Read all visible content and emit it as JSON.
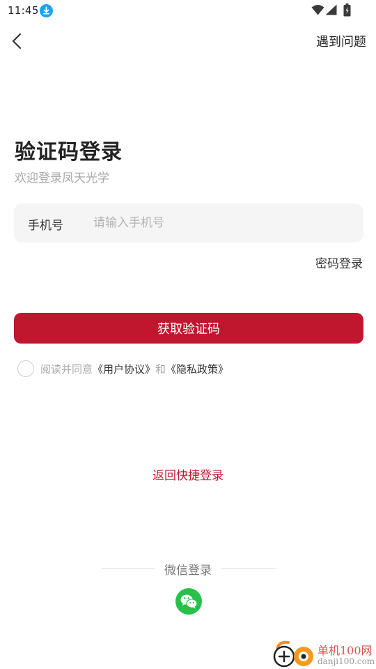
{
  "status_bar": {
    "time": "11:45",
    "icons": [
      "download-icon",
      "wifi-icon",
      "signal-icon",
      "battery-icon"
    ]
  },
  "nav": {
    "back_icon": "chevron-left-icon",
    "help_label": "遇到问题"
  },
  "header": {
    "title": "验证码登录",
    "subtitle": "欢迎登录凤天光学"
  },
  "phone": {
    "label": "手机号",
    "value": "",
    "placeholder": "请输入手机号"
  },
  "password_login_label": "密码登录",
  "get_code_label": "获取验证码",
  "agreement": {
    "checked": false,
    "prefix": "阅读并同意",
    "user_agreement": "《用户协议》",
    "conjunction": "和",
    "privacy_policy": "《隐私政策》"
  },
  "quick_login_label": "返回快捷登录",
  "wechat": {
    "label": "微信登录",
    "icon": "wechat-icon"
  },
  "watermark": {
    "name": "单机100网",
    "url": "danji100.com"
  },
  "colors": {
    "brand": "#c0172f",
    "wechat": "#27c04a",
    "download_badge": "#1fa2f0"
  }
}
